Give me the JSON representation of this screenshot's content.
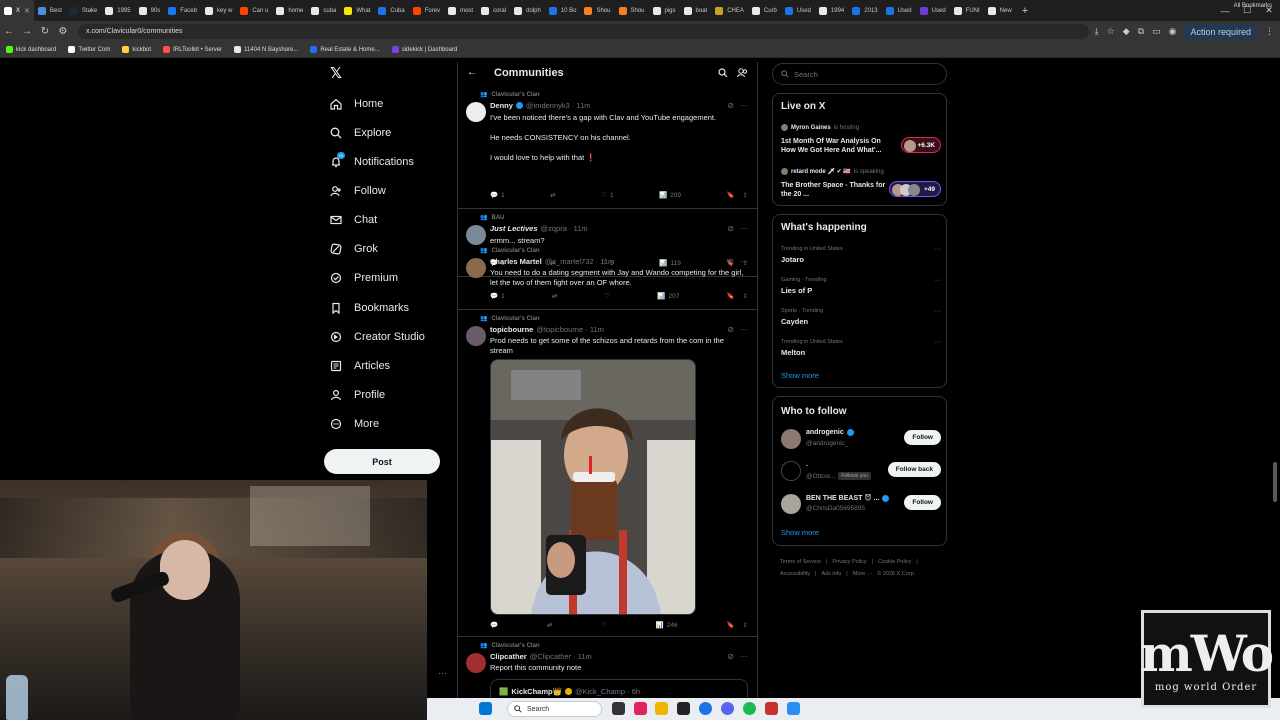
{
  "browser": {
    "tabs": [
      {
        "label": "X",
        "color": "#ffffff",
        "active": true
      },
      {
        "label": "Best",
        "color": "#4a90e2"
      },
      {
        "label": "Stake",
        "color": "#1a2c38"
      },
      {
        "label": "1995",
        "color": "#e8e8e8"
      },
      {
        "label": "90s",
        "color": "#e8e8e8"
      },
      {
        "label": "Faceb",
        "color": "#1877f2"
      },
      {
        "label": "key w",
        "color": "#e8e8e8"
      },
      {
        "label": "Can u",
        "color": "#ff4500"
      },
      {
        "label": "home",
        "color": "#e8e8e8"
      },
      {
        "label": "cuba",
        "color": "#e8e8e8"
      },
      {
        "label": "What",
        "color": "#f7e600"
      },
      {
        "label": "Cuba",
        "color": "#1a73e8"
      },
      {
        "label": "Forev",
        "color": "#ff4500"
      },
      {
        "label": "most",
        "color": "#e8e8e8"
      },
      {
        "label": "coral",
        "color": "#e8e8e8"
      },
      {
        "label": "dolph",
        "color": "#e8e8e8"
      },
      {
        "label": "10 Bo",
        "color": "#1a73e8"
      },
      {
        "label": "Shou",
        "color": "#f48024"
      },
      {
        "label": "Shou",
        "color": "#f48024"
      },
      {
        "label": "pigs",
        "color": "#e8e8e8"
      },
      {
        "label": "boat",
        "color": "#e8e8e8"
      },
      {
        "label": "CHEA",
        "color": "#c9a227"
      },
      {
        "label": "Curb",
        "color": "#e8e8e8"
      },
      {
        "label": "Used",
        "color": "#1a73e8"
      },
      {
        "label": "1994",
        "color": "#e8e8e8"
      },
      {
        "label": "2013",
        "color": "#1a73e8"
      },
      {
        "label": "Used",
        "color": "#1a73e8"
      },
      {
        "label": "Used",
        "color": "#6b3fd4"
      },
      {
        "label": "FUNI",
        "color": "#e8e8e8"
      },
      {
        "label": "New",
        "color": "#e8e8e8"
      }
    ],
    "new_tab": "+",
    "url": "x.com/Clavicular0/communities",
    "action_required": "Action required",
    "bookmarks": [
      {
        "label": "kick dashboard",
        "color": "#53fc18"
      },
      {
        "label": "Twitter Com",
        "color": "#ffffff"
      },
      {
        "label": "kickbot",
        "color": "#ffd33d"
      },
      {
        "label": "IRLToolkit • Server",
        "color": "#ff4d4d"
      },
      {
        "label": "11404 N Bayshore...",
        "color": "#e8e8e8"
      },
      {
        "label": "Real Estate & Home...",
        "color": "#1a73e8"
      },
      {
        "label": "sidekick | Dashboard",
        "color": "#7b3fe4"
      }
    ],
    "all_bookmarks": "All Bookmarks"
  },
  "nav": {
    "items": [
      {
        "label": "Home",
        "icon": "home-icon"
      },
      {
        "label": "Explore",
        "icon": "search-icon"
      },
      {
        "label": "Notifications",
        "icon": "bell-icon",
        "badge": "19"
      },
      {
        "label": "Follow",
        "icon": "follow-icon"
      },
      {
        "label": "Chat",
        "icon": "mail-icon"
      },
      {
        "label": "Grok",
        "icon": "grok-icon"
      },
      {
        "label": "Premium",
        "icon": "premium-icon"
      },
      {
        "label": "Bookmarks",
        "icon": "bookmark-icon"
      },
      {
        "label": "Creator Studio",
        "icon": "creator-icon"
      },
      {
        "label": "Articles",
        "icon": "articles-icon"
      },
      {
        "label": "Profile",
        "icon": "profile-icon"
      },
      {
        "label": "More",
        "icon": "more-icon"
      }
    ],
    "post_label": "Post"
  },
  "feed": {
    "title": "Communities",
    "posts": [
      {
        "community": "Clavicular's Clan",
        "name": "Denny",
        "handle": "@imdennyk3 · 11m",
        "lines": [
          "I've been noticed there's a gap with Clav and YouTube engagement.",
          "",
          "He needs CONSISTENCY on his channel.",
          "",
          "I would love to help with that ❗"
        ],
        "replies": "1",
        "reposts": "",
        "likes": "1",
        "views": "209"
      },
      {
        "community": "BAU",
        "name": "Just Lectives",
        "handle": "@zqpra · 11m",
        "lines": [
          "ermm... stream?"
        ],
        "replies": "1",
        "reposts": "",
        "likes": "5",
        "views": "119"
      },
      {
        "community": "Clavicular's Clan",
        "name": "Charles Martel",
        "handle": "@c_martel732 · 11m",
        "lines": [
          "You need to do a dating segment with Jay and Wando competing for the girl, let the two of them fight over an OF whore."
        ],
        "replies": "1",
        "reposts": "",
        "likes": "",
        "views": "207"
      },
      {
        "community": "Clavicular's Clan",
        "name": "topicbourne",
        "handle": "@topicbourne · 11m",
        "lines": [
          "Prod needs to get some of the schizos and retards from the com in the stream"
        ],
        "replies": "",
        "reposts": "",
        "likes": "",
        "views": "246"
      },
      {
        "community": "Clavicular's Clan",
        "name": "Clipcather",
        "handle": "@Clipcather · 11m",
        "lines": [
          "Report this community note"
        ],
        "quote_name": "KickChamp👑",
        "quote_handle": "@Kick_Champ · 6h"
      }
    ]
  },
  "right": {
    "search_placeholder": "Search",
    "live_title": "Live on X",
    "live": [
      {
        "host": "Myron Gaines",
        "suffix": "is hosting",
        "title": "1st Month Of War Analysis On How We Got Here And What'...",
        "count": "+6.3K"
      },
      {
        "host": "retard mode 🗡 ✔ 🇺🇸",
        "suffix": "is speaking",
        "title": "The Brother Space - Thanks for the 20 ...",
        "count": "+49"
      }
    ],
    "happening_title": "What's happening",
    "trends": [
      {
        "context": "Trending in United States",
        "name": "Jotaro"
      },
      {
        "context": "Gaming · Trending",
        "name": "Lies of P"
      },
      {
        "context": "Sports · Trending",
        "name": "Cayden"
      },
      {
        "context": "Trending in United States",
        "name": "Melton"
      }
    ],
    "show_more": "Show more",
    "wtf_title": "Who to follow",
    "follow": [
      {
        "name": "androgenic",
        "handle": "@androgenic_",
        "button": "Follow"
      },
      {
        "name": ".",
        "handle": "@Ottost...",
        "follows_you": "Follows you",
        "button": "Follow back"
      },
      {
        "name": "BEN THE BEAST 😈 ...",
        "handle": "@ChrisDa05695895",
        "button": "Follow"
      }
    ],
    "footer": [
      "Terms of Service",
      "|",
      "Privacy Policy",
      "|",
      "Cookie Policy",
      "|",
      "Accessibility",
      "|",
      "Ads info",
      "|",
      "More ···",
      "© 2026 X Corp."
    ]
  },
  "taskbar": {
    "search_placeholder": "Search"
  },
  "overlay": {
    "logo_big": "mWo",
    "logo_small": "mog world Order"
  }
}
